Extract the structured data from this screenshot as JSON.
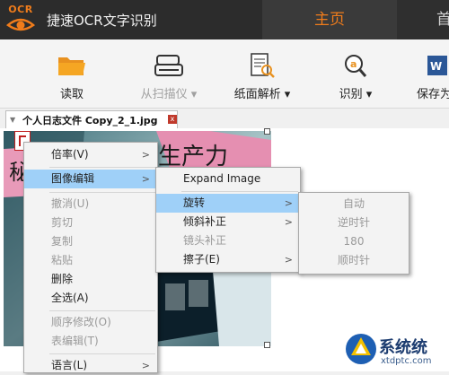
{
  "app": {
    "logo_text": "OCR",
    "title": "捷速OCR文字识别"
  },
  "nav": {
    "home": "主页",
    "next": "首"
  },
  "toolbar": {
    "read": "读取",
    "scan": "从扫描仪 ▾",
    "parse": "纸面解析 ▾",
    "recognize": "识别 ▾",
    "save": "保存为"
  },
  "tab": {
    "name": "个人日志文件 Copy_2_1.jpg",
    "close": "x",
    "grip": "▼"
  },
  "photo": {
    "text1": "生产力",
    "text2": "秘"
  },
  "menu1": {
    "items": [
      {
        "label": "倍率(V)",
        "arrow": ">",
        "disabled": false
      },
      {
        "label": "图像编辑",
        "arrow": ">",
        "disabled": false,
        "highlighted": true
      },
      {
        "label": "撤消(U)",
        "disabled": true
      },
      {
        "label": "剪切",
        "disabled": true
      },
      {
        "label": "复制",
        "disabled": true
      },
      {
        "label": "粘贴",
        "disabled": true
      },
      {
        "label": "删除",
        "disabled": false
      },
      {
        "label": "全选(A)",
        "disabled": false
      },
      {
        "label": "顺序修改(O)",
        "disabled": true
      },
      {
        "label": "表编辑(T)",
        "disabled": true
      },
      {
        "label": "语言(L)",
        "arrow": ">",
        "disabled": false
      }
    ]
  },
  "menu2": {
    "items": [
      {
        "label": "Expand Image",
        "disabled": false
      },
      {
        "label": "旋转",
        "arrow": ">",
        "disabled": false,
        "highlighted": true
      },
      {
        "label": "倾斜补正",
        "arrow": ">",
        "disabled": false
      },
      {
        "label": "镜头补正",
        "disabled": true
      },
      {
        "label": "擦子(E)",
        "arrow": ">",
        "disabled": false
      }
    ]
  },
  "menu3": {
    "items": [
      {
        "label": "自动",
        "disabled": true
      },
      {
        "label": "逆时针",
        "disabled": true
      },
      {
        "label": "180",
        "disabled": true
      },
      {
        "label": "顺时针",
        "disabled": true
      }
    ]
  },
  "watermark": {
    "title": "系统统",
    "url": "xtdptc.com"
  },
  "colors": {
    "accent": "#f07c1b",
    "titlebar": "#2c2c2c",
    "highlight": "#9fd0f8"
  },
  "icons": {
    "read": "folder-icon",
    "scan": "scanner-icon",
    "parse": "document-search-icon",
    "recognize": "ocr-magnifier-icon",
    "save": "word-document-icon"
  }
}
